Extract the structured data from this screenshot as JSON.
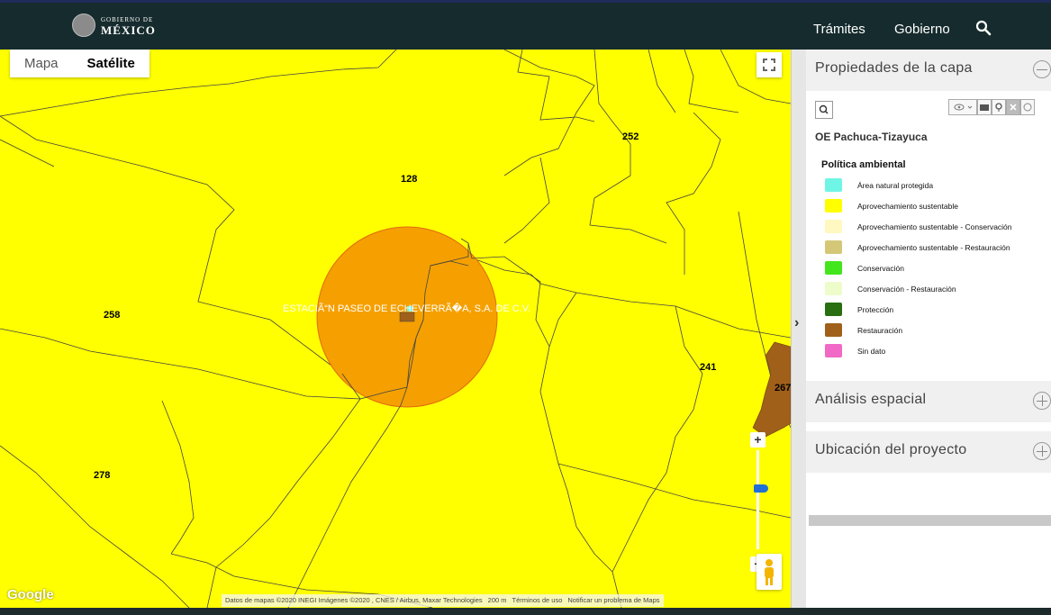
{
  "header": {
    "logo_line1": "GOBIERNO DE",
    "logo_line2": "MÉXICO",
    "nav_tramites": "Trámites",
    "nav_gobierno": "Gobierno",
    "search_icon": "search-icon"
  },
  "map": {
    "type_map": "Mapa",
    "type_satellite": "Satélite",
    "parcels": [
      "128",
      "252",
      "258",
      "241",
      "267",
      "278"
    ],
    "station_label": "ESTACIÃ“N PASEO DE ECHEVERRÃ�A, S.A. DE C.V.",
    "zoom_in": "+",
    "zoom_out": "−",
    "google": "Google",
    "attribution": "Datos de mapas ©2020 INEGI Imágenes ©2020 , CNES / Airbus, Maxar Technologies",
    "scale": "200 m",
    "terms": "Términos de uso",
    "report": "Notificar un problema de Maps",
    "colors": {
      "base": "#ffff00",
      "buffer": "#f5a000",
      "brown": "#a0601a"
    }
  },
  "panel": {
    "properties_title": "Propiedades de la capa",
    "layer_name": "OE Pachuca-Tizayuca",
    "legend_title": "Política ambiental",
    "legend": [
      {
        "label": "Área natural protegida",
        "color": "#6ff5e5"
      },
      {
        "label": "Aprovechamiento sustentable",
        "color": "#ffff00"
      },
      {
        "label": "Aprovechamiento sustentable - Conservación",
        "color": "#fff8c0"
      },
      {
        "label": "Aprovechamiento sustentable - Restauración",
        "color": "#d4c878"
      },
      {
        "label": "Conservación",
        "color": "#43e61c"
      },
      {
        "label": "Conservación - Restauración",
        "color": "#eefccc"
      },
      {
        "label": "Protección",
        "color": "#2a6e12"
      },
      {
        "label": "Restauración",
        "color": "#a0601a"
      },
      {
        "label": "Sin dato",
        "color": "#f268c6"
      }
    ],
    "spatial_title": "Análisis espacial",
    "location_title": "Ubicación del proyecto"
  }
}
